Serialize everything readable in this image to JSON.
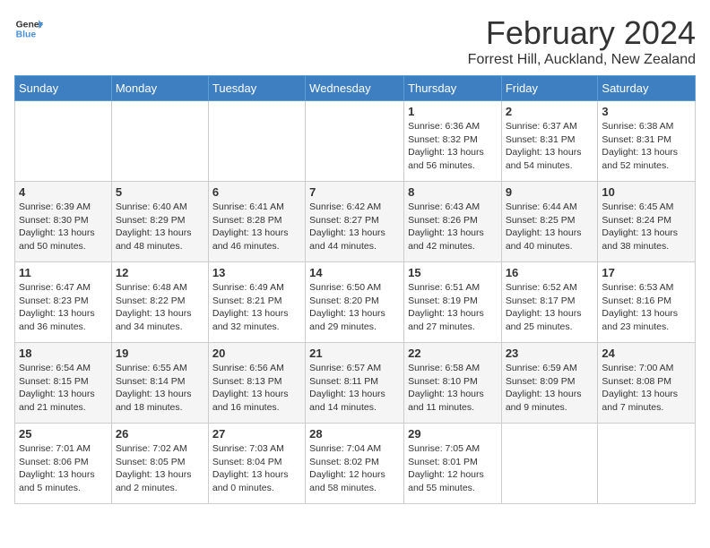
{
  "logo": {
    "general": "General",
    "blue": "Blue"
  },
  "title": {
    "month": "February 2024",
    "location": "Forrest Hill, Auckland, New Zealand"
  },
  "headers": [
    "Sunday",
    "Monday",
    "Tuesday",
    "Wednesday",
    "Thursday",
    "Friday",
    "Saturday"
  ],
  "weeks": [
    [
      {
        "day": "",
        "info": ""
      },
      {
        "day": "",
        "info": ""
      },
      {
        "day": "",
        "info": ""
      },
      {
        "day": "",
        "info": ""
      },
      {
        "day": "1",
        "info": "Sunrise: 6:36 AM\nSunset: 8:32 PM\nDaylight: 13 hours and 56 minutes."
      },
      {
        "day": "2",
        "info": "Sunrise: 6:37 AM\nSunset: 8:31 PM\nDaylight: 13 hours and 54 minutes."
      },
      {
        "day": "3",
        "info": "Sunrise: 6:38 AM\nSunset: 8:31 PM\nDaylight: 13 hours and 52 minutes."
      }
    ],
    [
      {
        "day": "4",
        "info": "Sunrise: 6:39 AM\nSunset: 8:30 PM\nDaylight: 13 hours and 50 minutes."
      },
      {
        "day": "5",
        "info": "Sunrise: 6:40 AM\nSunset: 8:29 PM\nDaylight: 13 hours and 48 minutes."
      },
      {
        "day": "6",
        "info": "Sunrise: 6:41 AM\nSunset: 8:28 PM\nDaylight: 13 hours and 46 minutes."
      },
      {
        "day": "7",
        "info": "Sunrise: 6:42 AM\nSunset: 8:27 PM\nDaylight: 13 hours and 44 minutes."
      },
      {
        "day": "8",
        "info": "Sunrise: 6:43 AM\nSunset: 8:26 PM\nDaylight: 13 hours and 42 minutes."
      },
      {
        "day": "9",
        "info": "Sunrise: 6:44 AM\nSunset: 8:25 PM\nDaylight: 13 hours and 40 minutes."
      },
      {
        "day": "10",
        "info": "Sunrise: 6:45 AM\nSunset: 8:24 PM\nDaylight: 13 hours and 38 minutes."
      }
    ],
    [
      {
        "day": "11",
        "info": "Sunrise: 6:47 AM\nSunset: 8:23 PM\nDaylight: 13 hours and 36 minutes."
      },
      {
        "day": "12",
        "info": "Sunrise: 6:48 AM\nSunset: 8:22 PM\nDaylight: 13 hours and 34 minutes."
      },
      {
        "day": "13",
        "info": "Sunrise: 6:49 AM\nSunset: 8:21 PM\nDaylight: 13 hours and 32 minutes."
      },
      {
        "day": "14",
        "info": "Sunrise: 6:50 AM\nSunset: 8:20 PM\nDaylight: 13 hours and 29 minutes."
      },
      {
        "day": "15",
        "info": "Sunrise: 6:51 AM\nSunset: 8:19 PM\nDaylight: 13 hours and 27 minutes."
      },
      {
        "day": "16",
        "info": "Sunrise: 6:52 AM\nSunset: 8:17 PM\nDaylight: 13 hours and 25 minutes."
      },
      {
        "day": "17",
        "info": "Sunrise: 6:53 AM\nSunset: 8:16 PM\nDaylight: 13 hours and 23 minutes."
      }
    ],
    [
      {
        "day": "18",
        "info": "Sunrise: 6:54 AM\nSunset: 8:15 PM\nDaylight: 13 hours and 21 minutes."
      },
      {
        "day": "19",
        "info": "Sunrise: 6:55 AM\nSunset: 8:14 PM\nDaylight: 13 hours and 18 minutes."
      },
      {
        "day": "20",
        "info": "Sunrise: 6:56 AM\nSunset: 8:13 PM\nDaylight: 13 hours and 16 minutes."
      },
      {
        "day": "21",
        "info": "Sunrise: 6:57 AM\nSunset: 8:11 PM\nDaylight: 13 hours and 14 minutes."
      },
      {
        "day": "22",
        "info": "Sunrise: 6:58 AM\nSunset: 8:10 PM\nDaylight: 13 hours and 11 minutes."
      },
      {
        "day": "23",
        "info": "Sunrise: 6:59 AM\nSunset: 8:09 PM\nDaylight: 13 hours and 9 minutes."
      },
      {
        "day": "24",
        "info": "Sunrise: 7:00 AM\nSunset: 8:08 PM\nDaylight: 13 hours and 7 minutes."
      }
    ],
    [
      {
        "day": "25",
        "info": "Sunrise: 7:01 AM\nSunset: 8:06 PM\nDaylight: 13 hours and 5 minutes."
      },
      {
        "day": "26",
        "info": "Sunrise: 7:02 AM\nSunset: 8:05 PM\nDaylight: 13 hours and 2 minutes."
      },
      {
        "day": "27",
        "info": "Sunrise: 7:03 AM\nSunset: 8:04 PM\nDaylight: 13 hours and 0 minutes."
      },
      {
        "day": "28",
        "info": "Sunrise: 7:04 AM\nSunset: 8:02 PM\nDaylight: 12 hours and 58 minutes."
      },
      {
        "day": "29",
        "info": "Sunrise: 7:05 AM\nSunset: 8:01 PM\nDaylight: 12 hours and 55 minutes."
      },
      {
        "day": "",
        "info": ""
      },
      {
        "day": "",
        "info": ""
      }
    ]
  ]
}
